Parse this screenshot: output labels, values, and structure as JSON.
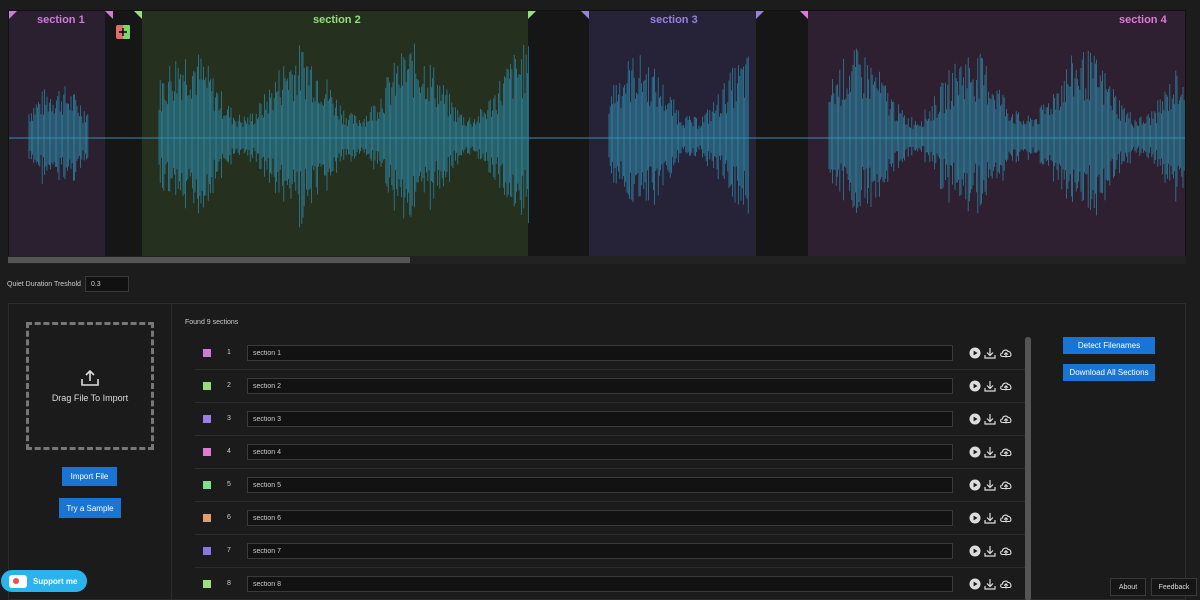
{
  "sections": [
    {
      "label": "section 1",
      "color": "#d27ad9"
    },
    {
      "label": "section 2",
      "color": "#93e07a"
    },
    {
      "label": "section 3",
      "color": "#9a7ee8"
    },
    {
      "label": "section 4",
      "color": "#e07ad6"
    }
  ],
  "controls": {
    "threshold_label": "Quiet Duration Treshold",
    "threshold_value": "0.3"
  },
  "import": {
    "drop_label": "Drag File To Import",
    "import_button": "Import File",
    "sample_button": "Try a Sample",
    "support_label": "Support me"
  },
  "list": {
    "found_label": "Found 9 sections",
    "rows": [
      {
        "num": "1",
        "name": "section 1",
        "color": "#d27ad9"
      },
      {
        "num": "2",
        "name": "section 2",
        "color": "#93e07a"
      },
      {
        "num": "3",
        "name": "section 3",
        "color": "#9a7ee8"
      },
      {
        "num": "4",
        "name": "section 4",
        "color": "#e07ad6"
      },
      {
        "num": "5",
        "name": "section 5",
        "color": "#7ee08a"
      },
      {
        "num": "6",
        "name": "section 6",
        "color": "#e0a06e"
      },
      {
        "num": "7",
        "name": "section 7",
        "color": "#8a78e0"
      },
      {
        "num": "8",
        "name": "section 8",
        "color": "#9be07e"
      }
    ]
  },
  "actions": {
    "detect_button": "Detect Filenames",
    "download_all_button": "Download All Sections"
  },
  "footer": {
    "about": "About",
    "feedback": "Feedback"
  },
  "icons": {
    "row": [
      "play-icon",
      "download-icon",
      "cloud-upload-icon"
    ],
    "merge": "merge-plus-icon",
    "upload": "upload-icon"
  }
}
